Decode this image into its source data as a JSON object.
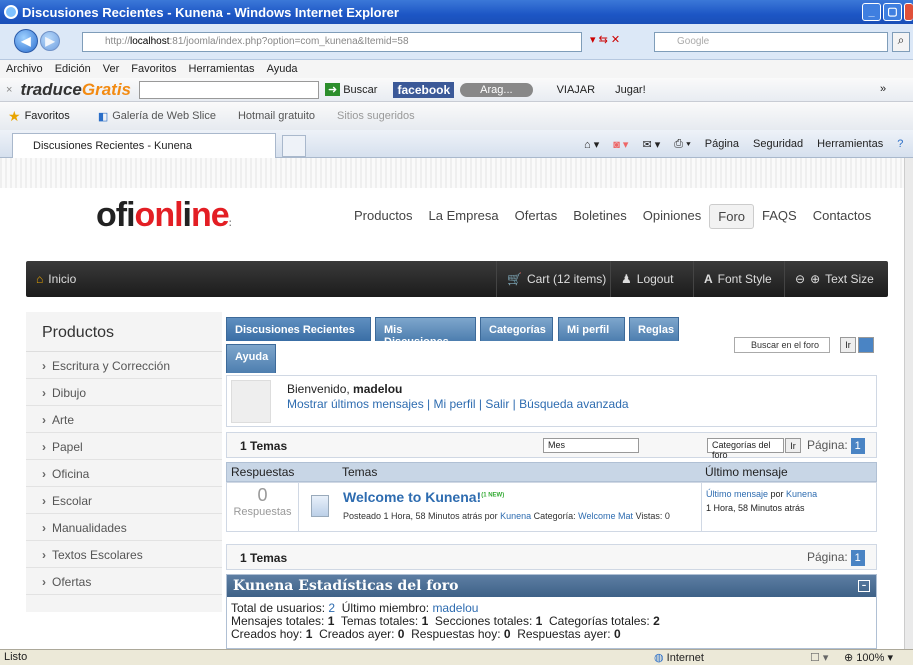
{
  "window": {
    "title": "Discusiones Recientes - Kunena - Windows Internet Explorer"
  },
  "address": {
    "url_host": "http://",
    "url_bold": "localhost",
    "url_rest": ":81/joomla/index.php?option=com_kunena&Itemid=58",
    "search_placeholder": "Google"
  },
  "menu": [
    "Archivo",
    "Edición",
    "Ver",
    "Favoritos",
    "Herramientas",
    "Ayuda"
  ],
  "toolbar1": {
    "brand1": "traduce",
    "brand2": "Gratis",
    "search_label": "Buscar",
    "facebook": "facebook",
    "arag": "Arag...",
    "viajar": "VIAJAR",
    "jugar": "Jugar!"
  },
  "toolbar2": {
    "favorites": "Favoritos",
    "gallery": "Galería de Web Slice",
    "hotmail": "Hotmail gratuito",
    "suggested": "Sitios sugeridos",
    "pagina": "Página",
    "seguridad": "Seguridad",
    "herramientas": "Herramientas"
  },
  "tab": {
    "label": "Discusiones Recientes - Kunena"
  },
  "site": {
    "logo_a": "ofi",
    "logo_b": "onl",
    "logo_c": "ne",
    "nav": [
      "Productos",
      "La Empresa",
      "Ofertas",
      "Boletines",
      "Opiniones",
      "Foro",
      "FAQS",
      "Contactos"
    ],
    "bar": {
      "home": "Inicio",
      "cart": "Cart (12 items)",
      "logout": "Logout",
      "font": "Font Style",
      "text": "Text Size"
    }
  },
  "sidebar": {
    "title": "Productos",
    "items": [
      "Escritura y Corrección",
      "Dibujo",
      "Arte",
      "Papel",
      "Oficina",
      "Escolar",
      "Manualidades",
      "Textos Escolares",
      "Ofertas"
    ]
  },
  "kunena": {
    "tabs": [
      "Discusiones Recientes",
      "Mis Discusiones",
      "Categorías",
      "Mi perfil",
      "Reglas",
      "Ayuda"
    ],
    "search_placeholder": "Buscar en el foro",
    "go": "Ir",
    "welcome_pre": "Bienvenido, ",
    "user": "madelou",
    "links": [
      "Mostrar últimos mensajes",
      "Mi perfil",
      "Salir",
      "Búsqueda avanzada"
    ],
    "temas_count": "1 Temas",
    "period": "Mes",
    "cat_select": "Categorías del foro",
    "page_label": "Página:",
    "page_num": "1",
    "columns": [
      "Respuestas",
      "Temas",
      "Último mensaje"
    ],
    "row": {
      "replies": "0",
      "replies_label": "Respuestas",
      "title": "Welcome to Kunena!",
      "new": "(1 NEW)",
      "meta_pre": "Posteado 1 Hora, 58 Minutos atrás por ",
      "author": "Kunena",
      "cat_label": " Categoría: ",
      "category": "Welcome Mat",
      "views": " Vistas: 0",
      "last_link": "Último mensaje",
      "last_by": " por ",
      "last_author": "Kunena",
      "last_time": "1 Hora, 58 Minutos atrás"
    },
    "stats": {
      "title": "Kunena Estadísticas del foro",
      "line1_a": "Total de usuarios: ",
      "users": "2",
      "line1_b": "Último miembro: ",
      "member": "madelou",
      "line2": [
        [
          "Mensajes totales: ",
          "1"
        ],
        [
          "Temas totales: ",
          "1"
        ],
        [
          "Secciones totales: ",
          "1"
        ],
        [
          "Categorías totales: ",
          "2"
        ]
      ],
      "line3": [
        [
          "Creados hoy: ",
          "1"
        ],
        [
          "Creados ayer: ",
          "0"
        ],
        [
          "Respuestas hoy: ",
          "0"
        ],
        [
          "Respuestas ayer: ",
          "0"
        ]
      ]
    }
  },
  "status": {
    "left": "Listo",
    "zone": "Internet",
    "zoom": "100%"
  }
}
